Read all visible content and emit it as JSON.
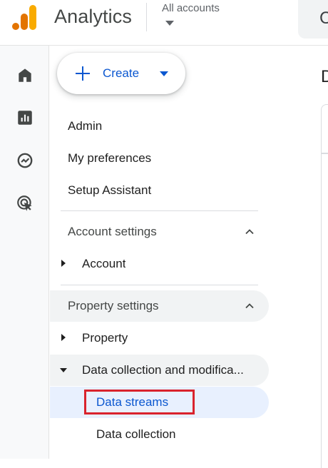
{
  "app": {
    "title": "Analytics"
  },
  "account_selector": {
    "label": "All accounts"
  },
  "colors": {
    "logo_dark": "#e37400",
    "logo_light": "#f9ab00",
    "accent": "#0b57d0",
    "highlight_box": "#d9232d"
  },
  "rail": {
    "items": [
      {
        "icon": "home-icon"
      },
      {
        "icon": "reports-icon"
      },
      {
        "icon": "explore-icon"
      },
      {
        "icon": "advertising-icon"
      }
    ]
  },
  "create_button": {
    "label": "Create"
  },
  "menu": {
    "admin": "Admin",
    "preferences": "My preferences",
    "setup": "Setup Assistant"
  },
  "sections": {
    "account_settings": {
      "label": "Account settings",
      "items": {
        "account": "Account"
      }
    },
    "property_settings": {
      "label": "Property settings",
      "items": {
        "property": "Property",
        "data_collection_group": "Data collection and modifica...",
        "data_streams": "Data streams",
        "data_collection": "Data collection"
      }
    }
  },
  "main_peek": {
    "heading_initial": "D"
  },
  "search_peek": {
    "glyph": "C"
  }
}
